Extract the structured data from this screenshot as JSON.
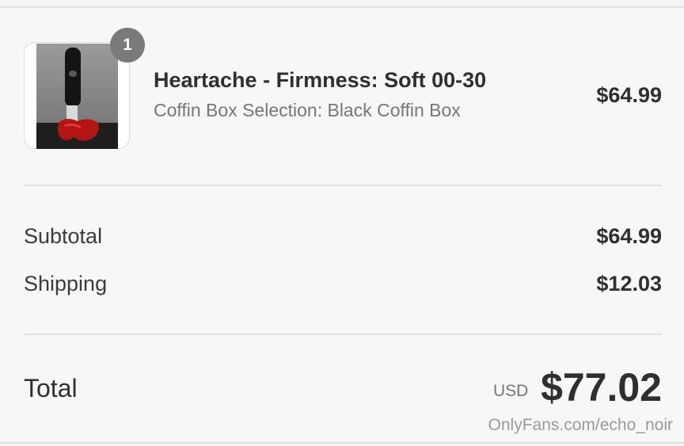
{
  "line_item": {
    "quantity": "1",
    "title": "Heartache - Firmness: Soft 00-30",
    "variant": "Coffin Box Selection: Black Coffin Box",
    "price": "$64.99",
    "thumbnail_icon": "product-photo"
  },
  "summary": {
    "subtotal_label": "Subtotal",
    "subtotal_value": "$64.99",
    "shipping_label": "Shipping",
    "shipping_value": "$12.03"
  },
  "total": {
    "label": "Total",
    "currency": "USD",
    "value": "$77.02"
  },
  "watermark": "OnlyFans.com/echo_noir",
  "colors": {
    "background": "#f7f7f7",
    "badge": "#7a7a7a",
    "text_primary": "#2f2f2f",
    "text_secondary": "#767676"
  }
}
